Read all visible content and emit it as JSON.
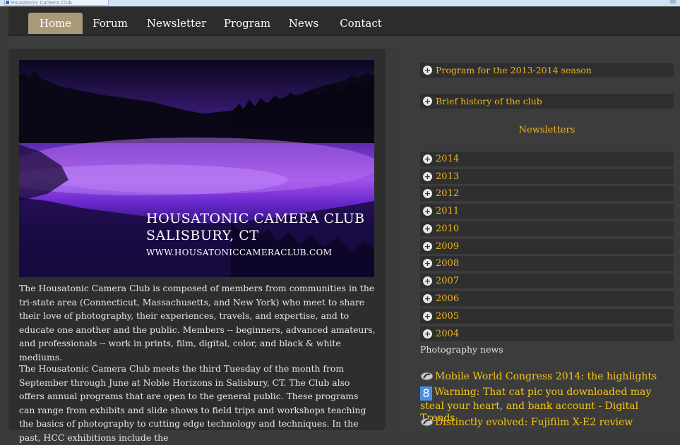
{
  "browser": {
    "tab_title": "Housatonic Camera Club"
  },
  "nav": {
    "items": [
      {
        "label": "Home",
        "active": true
      },
      {
        "label": "Forum",
        "active": false
      },
      {
        "label": "Newsletter",
        "active": false
      },
      {
        "label": "Program",
        "active": false
      },
      {
        "label": "News",
        "active": false
      },
      {
        "label": "Contact",
        "active": false
      }
    ]
  },
  "hero": {
    "title": "HOUSATONIC CAMERA CLUB",
    "subtitle": "SALISBURY, CT",
    "url": "WWW.HOUSATONICCAMERACLUB.COM"
  },
  "main": {
    "paragraph1": "The Housatonic Camera Club is composed of members from communities in the tri-state area (Connecticut, Massachusetts, and New York) who meet to share their love of photography, their experiences, travels, and expertise, and to educate one another and the public. Members -- beginners, advanced amateurs, and professionals -- work in prints, film, digital, color, and black & white mediums.",
    "paragraph2": "The Housatonic Camera Club meets the third Tuesday of the month from September through June at Noble Horizons in Salisbury, CT. The Club also offers annual programs that are open to the general public. These programs can range from exhibits and slide shows to field trips and workshops teaching the basics of photography to cutting edge technology and techniques. In the past, HCC exhibitions include the"
  },
  "sidebar": {
    "program": "Program for the 2013-2014 season",
    "history": "Brief history of the club",
    "newsletters_heading": "Newsletters",
    "years": [
      "2014",
      "2013",
      "2012",
      "2011",
      "2010",
      "2009",
      "2008",
      "2007",
      "2006",
      "2005",
      "2004"
    ],
    "news_heading": "Photography news",
    "news": [
      {
        "title": "Mobile World Congress 2014: the highlights",
        "icon": "news-feed-icon"
      },
      {
        "title": "Warning: That cat pic you downloaded may steal your heart, and bank account - Digital Trends",
        "icon": "google-icon",
        "icon_letter": "8"
      },
      {
        "title": "Distinctly evolved: Fujifilm X-E2 review",
        "icon": "news-feed-icon"
      }
    ]
  },
  "colors": {
    "accent": "#f0b51e",
    "nav_active": "#a89a79",
    "background": "#3b3b3b"
  }
}
